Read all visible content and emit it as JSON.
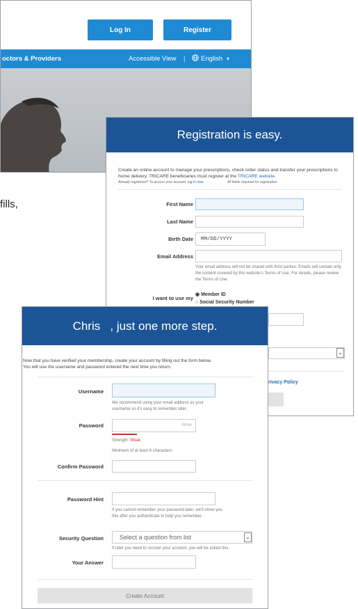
{
  "background": {
    "login_label": "Log In",
    "register_label": "Register",
    "nav_item": "octors & Providers",
    "accessible_view": "Accessible View",
    "separator": "|",
    "language": "English",
    "cropped_text": "fills,"
  },
  "registration": {
    "title": "Registration is easy.",
    "intro": "Create an online account to manage your prescriptions, check order status and transfer your prescriptions to home delivery. TRICARE beneficiaries must register at the",
    "tricare_link": "TRICARE website.",
    "already_registered": "Already registered? To access your account,",
    "log_in_link": "log in now.",
    "required_note": "All fields required for registration",
    "fields": {
      "first_name": "First Name",
      "last_name": "Last Name",
      "birth_date": "Birth Date",
      "birth_date_placeholder": "MM/DD/YYYY",
      "email": "Email Address",
      "email_note": "Your email address will not be shared with third parties. Emails will contain only the content covered by this website's Terms of Use. For details, please review the Terms of Use."
    },
    "use_my_label": "I want to use my",
    "option_member_id": "Member ID",
    "option_ssn": "Social Security Number",
    "privacy_policy": "rivacy Policy"
  },
  "step": {
    "title": "Chris   , just one more step.",
    "intro_line1": "Now that you have verified your membership, create your account by filling out the form below.",
    "intro_line2": "You will use the username and password entered the next time you return.",
    "username_label": "Username",
    "username_note": "We recommend using your email address as your username so it's easy to remember later.",
    "password_label": "Password",
    "password_show": "Show",
    "strength_label": "Strength:",
    "strength_value": "Weak",
    "password_min": "Minimum of at least 6 characters",
    "confirm_label": "Confirm Password",
    "hint_label": "Password Hint",
    "hint_note": "If you cannot remember your password later, we'll show you this after you authenticate to help you remember.",
    "security_label": "Security Question",
    "security_placeholder": "Select a question from list",
    "security_note": "If later you need to recover your account, you will be asked this.",
    "answer_label": "Your Answer",
    "create_button": "Create Account"
  },
  "colors": {
    "brand_blue": "#1f8ad3",
    "header_navy": "#1b5597",
    "weak_red": "#c0392b"
  }
}
